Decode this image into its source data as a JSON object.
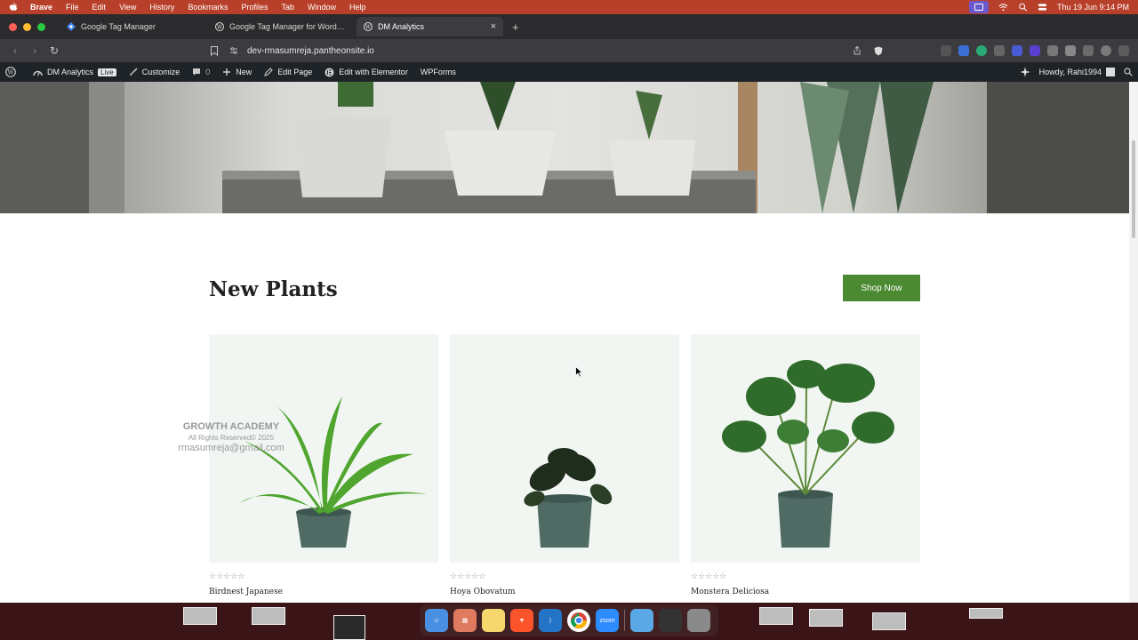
{
  "menubar": {
    "app_name": "Brave",
    "items": [
      "File",
      "Edit",
      "View",
      "History",
      "Bookmarks",
      "Profiles",
      "Tab",
      "Window",
      "Help"
    ],
    "clock": "Thu 19 Jun  9:14 PM",
    "bar_color": "#b8402a"
  },
  "browser": {
    "tabs": [
      {
        "label": "Google Tag Manager",
        "icon": "gtm-icon"
      },
      {
        "label": "Google Tag Manager for WordPress",
        "icon": "wordpress-icon"
      },
      {
        "label": "DM Analytics",
        "icon": "wordpress-icon",
        "active": true
      }
    ],
    "url": "dev-rmasumreja.pantheonsite.io"
  },
  "wp_admin_bar": {
    "site_name": "DM Analytics",
    "live_badge": "Live",
    "customize": "Customize",
    "comments_count": "0",
    "new": "New",
    "edit_page": "Edit Page",
    "edit_elementor": "Edit with Elementor",
    "wpforms": "WPForms",
    "greeting": "Howdy, Rahi1994"
  },
  "section": {
    "title": "New Plants",
    "shop_button": "Shop Now",
    "accent_color": "#4c8a32"
  },
  "products": [
    {
      "name": "Birdnest Japanese",
      "rating": 0,
      "rating_max": 5
    },
    {
      "name": "Hoya Obovatum",
      "rating": 0,
      "rating_max": 5
    },
    {
      "name": "Monstera Deliciosa",
      "rating": 0,
      "rating_max": 5
    }
  ],
  "watermark": {
    "line1": "GROWTH ACADEMY",
    "line2": "All Rights Reserved© 2025",
    "line3": "rmasumreja@gmail.com"
  }
}
